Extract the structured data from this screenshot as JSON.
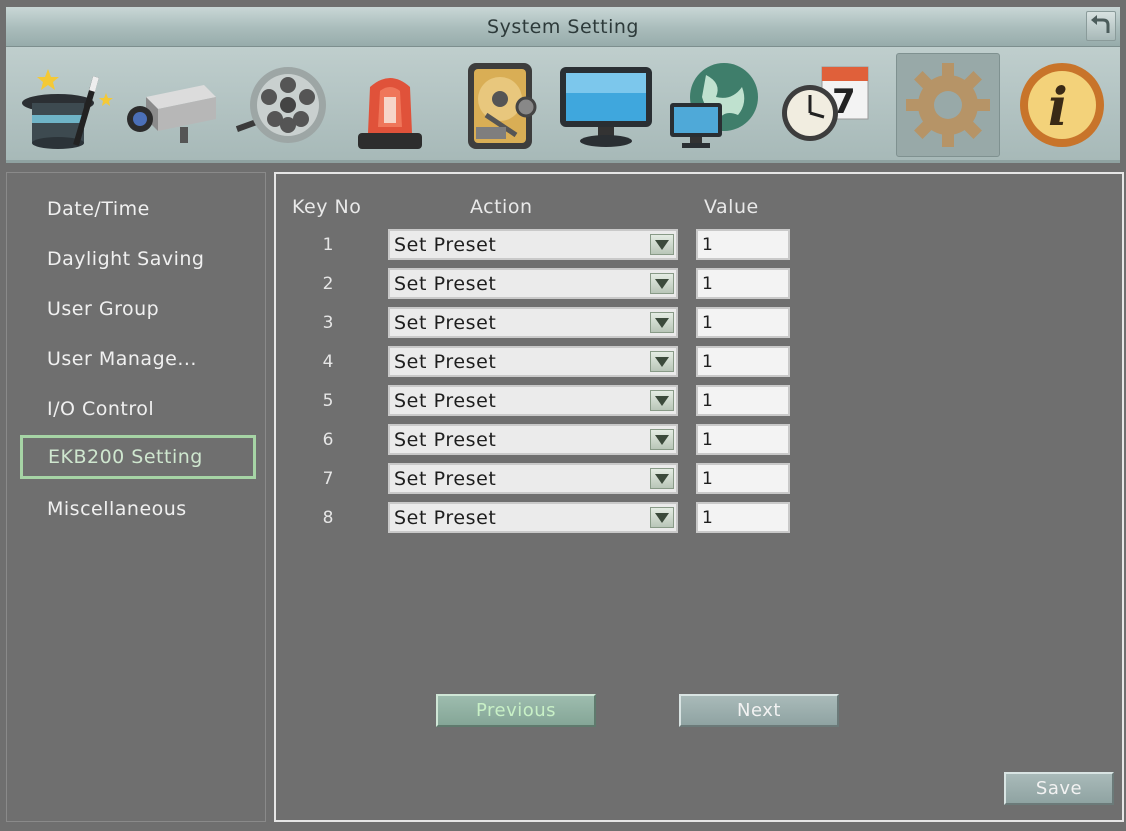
{
  "window": {
    "title": "System Setting"
  },
  "toolbar": {
    "icons": [
      "magic-hat-icon",
      "camera-icon",
      "record-reel-icon",
      "alarm-beacon-icon",
      "hard-disk-icon",
      "monitor-icon",
      "network-globe-icon",
      "schedule-clock-icon",
      "gear-icon",
      "info-icon"
    ],
    "active": "gear-icon",
    "calendar_day": "7",
    "info_glyph": "i"
  },
  "sidebar": {
    "items": [
      {
        "label": "Date/Time"
      },
      {
        "label": "Daylight Saving"
      },
      {
        "label": "User Group"
      },
      {
        "label": "User Manage..."
      },
      {
        "label": "I/O Control"
      },
      {
        "label": "EKB200 Setting",
        "active": true
      },
      {
        "label": "Miscellaneous"
      }
    ]
  },
  "table": {
    "headers": {
      "key_no": "Key No",
      "action": "Action",
      "value": "Value"
    },
    "rows": [
      {
        "key": "1",
        "action": "Set Preset",
        "value": "1"
      },
      {
        "key": "2",
        "action": "Set Preset",
        "value": "1"
      },
      {
        "key": "3",
        "action": "Set Preset",
        "value": "1"
      },
      {
        "key": "4",
        "action": "Set Preset",
        "value": "1"
      },
      {
        "key": "5",
        "action": "Set Preset",
        "value": "1"
      },
      {
        "key": "6",
        "action": "Set Preset",
        "value": "1"
      },
      {
        "key": "7",
        "action": "Set Preset",
        "value": "1"
      },
      {
        "key": "8",
        "action": "Set Preset",
        "value": "1"
      }
    ]
  },
  "buttons": {
    "previous": "Previous",
    "next": "Next",
    "save": "Save"
  },
  "colors": {
    "background": "#6f6f6f",
    "selected_outline": "#a6d4a5",
    "title_bar": "#a9bcbb"
  }
}
